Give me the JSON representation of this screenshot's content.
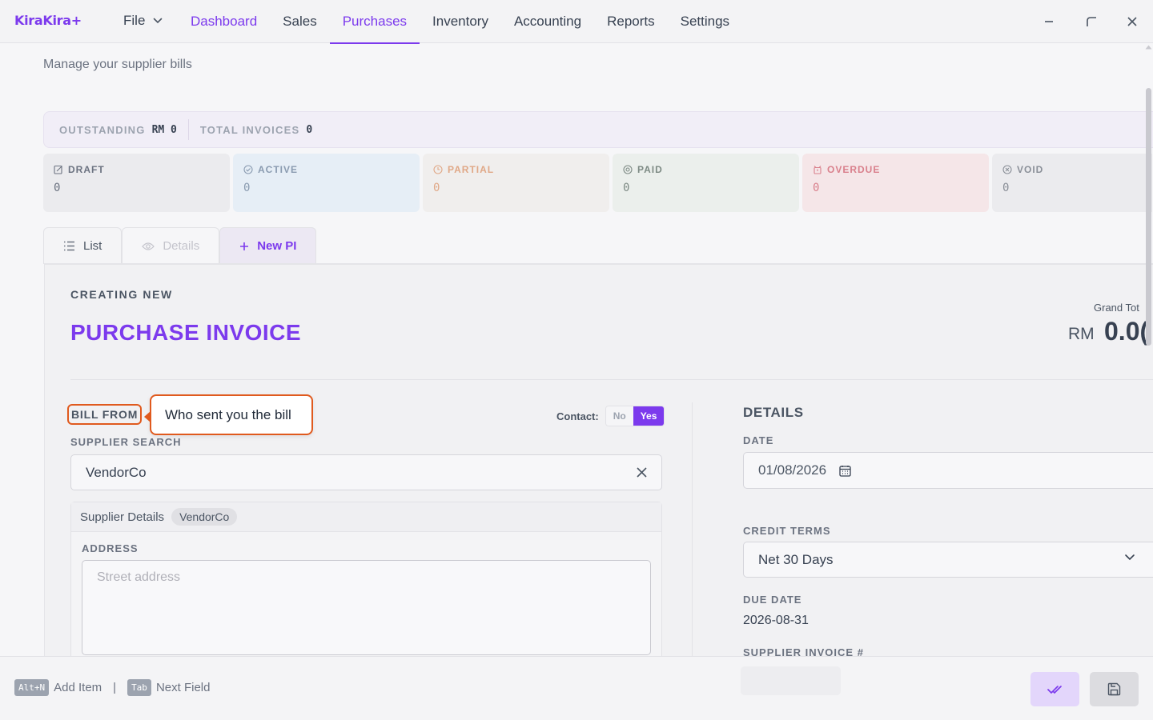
{
  "app": {
    "title": "KiraKira+"
  },
  "menu": {
    "file_label": "File"
  },
  "nav": {
    "tabs": [
      {
        "label": "Dashboard"
      },
      {
        "label": "Sales"
      },
      {
        "label": "Purchases",
        "active": true
      },
      {
        "label": "Inventory"
      },
      {
        "label": "Accounting"
      },
      {
        "label": "Reports"
      },
      {
        "label": "Settings"
      }
    ]
  },
  "page": {
    "subtitle": "Manage your supplier bills"
  },
  "stats": {
    "outstanding_label": "OUTSTANDING",
    "outstanding_value": "RM 0",
    "total_label": "TOTAL INVOICES",
    "total_value": "0"
  },
  "status_cards": [
    {
      "label": "DRAFT",
      "value": "0",
      "icon": "edit-icon",
      "bg": "#ebebee",
      "fg": "#6b7280"
    },
    {
      "label": "ACTIVE",
      "value": "0",
      "icon": "check-circle-icon",
      "bg": "#e6eef6",
      "fg": "#8a9bb0"
    },
    {
      "label": "PARTIAL",
      "value": "0",
      "icon": "clock-icon",
      "bg": "#f0eeed",
      "fg": "#e0a887"
    },
    {
      "label": "PAID",
      "value": "0",
      "icon": "dollar-circle-icon",
      "bg": "#ebefec",
      "fg": "#7d8a84"
    },
    {
      "label": "OVERDUE",
      "value": "0",
      "icon": "alarm-icon",
      "bg": "#f5e6e8",
      "fg": "#d9808c"
    },
    {
      "label": "VOID",
      "value": "0",
      "icon": "void-circle-icon",
      "bg": "#ebebee",
      "fg": "#8a8f98"
    }
  ],
  "tabs": {
    "list_label": "List",
    "details_label": "Details",
    "new_label": "New PI"
  },
  "form": {
    "creating_label": "CREATING NEW",
    "title": "PURCHASE INVOICE",
    "grand_total_label": "Grand Tot",
    "grand_total_currency": "RM",
    "grand_total_value": "0.0(",
    "bill_from_label": "BILL FROM",
    "callout_text": "Who sent you the bill",
    "contact_label": "Contact:",
    "contact_no": "No",
    "contact_yes": "Yes",
    "supplier_search_label": "SUPPLIER SEARCH",
    "supplier_search_value": "VendorCo",
    "supplier_details_label": "Supplier Details",
    "supplier_chip": "VendorCo",
    "address_label": "ADDRESS",
    "address_placeholder": "Street address",
    "details_heading": "DETAILS",
    "date_label": "DATE",
    "date_value": "01/08/2026",
    "credit_terms_label": "CREDIT TERMS",
    "credit_terms_value": "Net 30 Days",
    "due_date_label": "DUE DATE",
    "due_date_value": "2026-08-31",
    "supplier_invoice_label": "SUPPLIER INVOICE #"
  },
  "footer": {
    "hint1_key": "Alt+N",
    "hint1_text": "Add Item",
    "separator": "|",
    "hint2_key": "Tab",
    "hint2_text": "Next Field"
  },
  "colors": {
    "accent": "#7c3aed",
    "highlight": "#e05a1e"
  }
}
